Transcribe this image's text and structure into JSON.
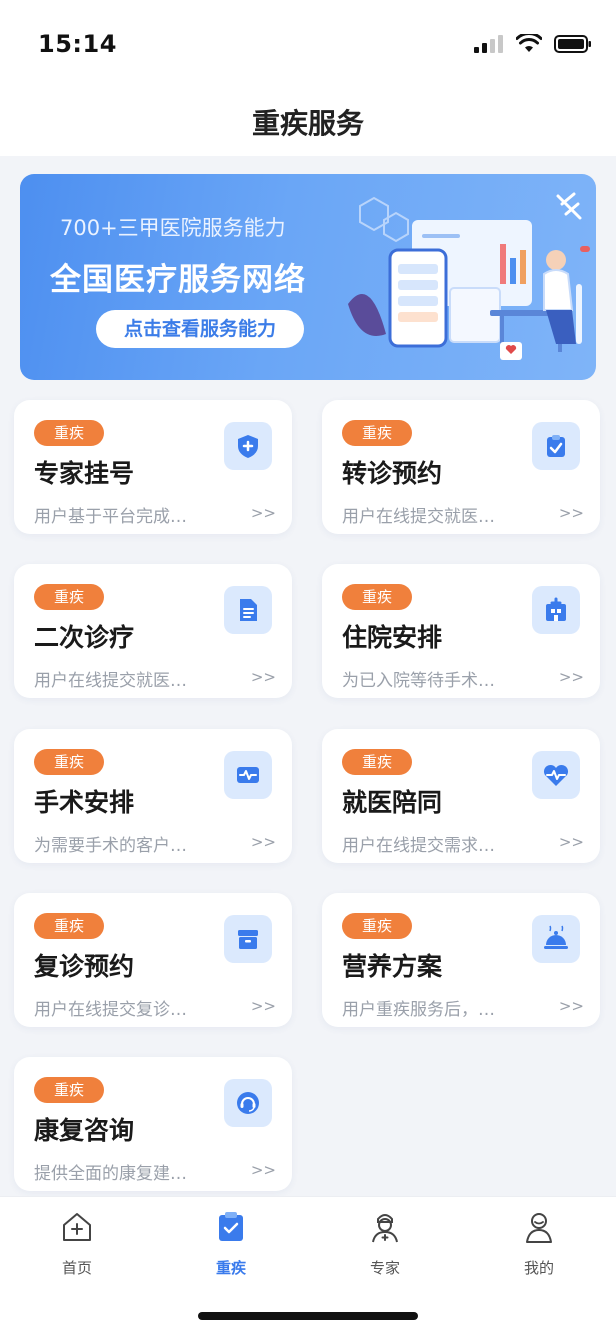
{
  "status_bar": {
    "time": "15:14"
  },
  "header": {
    "title": "重疾服务"
  },
  "banner": {
    "subtitle": "700+三甲医院服务能力",
    "title": "全国医疗服务网络",
    "button_label": "点击查看服务能力"
  },
  "cards": [
    {
      "tag": "重疾",
      "title": "专家挂号",
      "desc": "用户基于平台完成…",
      "more": ">>",
      "icon": "shield-plus-icon"
    },
    {
      "tag": "重疾",
      "title": "转诊预约",
      "desc": "用户在线提交就医…",
      "more": ">>",
      "icon": "clipboard-check-icon"
    },
    {
      "tag": "重疾",
      "title": "二次诊疗",
      "desc": "用户在线提交就医…",
      "more": ">>",
      "icon": "document-icon"
    },
    {
      "tag": "重疾",
      "title": "住院安排",
      "desc": "为已入院等待手术…",
      "more": ">>",
      "icon": "hospital-icon"
    },
    {
      "tag": "重疾",
      "title": "手术安排",
      "desc": "为需要手术的客户…",
      "more": ">>",
      "icon": "monitor-pulse-icon"
    },
    {
      "tag": "重疾",
      "title": "就医陪同",
      "desc": "用户在线提交需求…",
      "more": ">>",
      "icon": "heart-pulse-icon"
    },
    {
      "tag": "重疾",
      "title": "复诊预约",
      "desc": "用户在线提交复诊…",
      "more": ">>",
      "icon": "archive-box-icon"
    },
    {
      "tag": "重疾",
      "title": "营养方案",
      "desc": "用户重疾服务后，…",
      "more": ">>",
      "icon": "food-dome-icon"
    },
    {
      "tag": "重疾",
      "title": "康复咨询",
      "desc": "提供全面的康复建…",
      "more": ">>",
      "icon": "headset-icon"
    }
  ],
  "tabbar": {
    "items": [
      {
        "label": "首页",
        "icon": "home-icon",
        "active": false
      },
      {
        "label": "重疾",
        "icon": "clipboard-icon",
        "active": true
      },
      {
        "label": "专家",
        "icon": "doctor-icon",
        "active": false
      },
      {
        "label": "我的",
        "icon": "user-icon",
        "active": false
      }
    ]
  },
  "colors": {
    "accent": "#3a7bec",
    "tag": "#f0803c",
    "icon_bg": "#dbe9fd",
    "page_bg": "#f2f4f8"
  }
}
